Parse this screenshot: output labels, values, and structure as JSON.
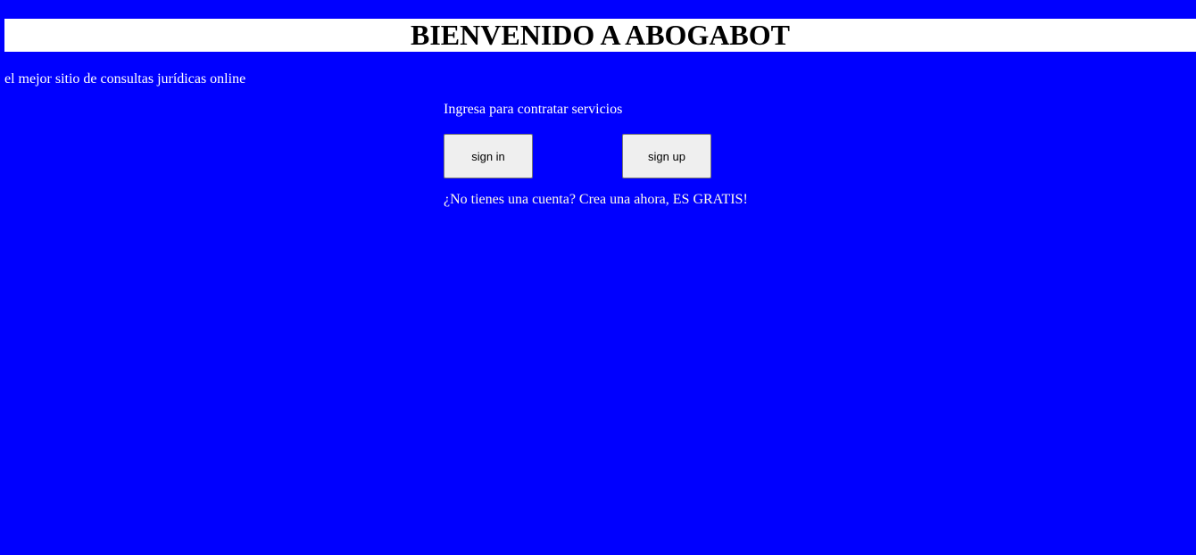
{
  "header": {
    "title": "BIENVENIDO A ABOGABOT"
  },
  "tagline": "el mejor sitio de consultas jurídicas online",
  "auth": {
    "prompt": "Ingresa para contratar servicios",
    "sign_in_label": "sign in",
    "sign_up_label": "sign up",
    "signup_note": "¿No tienes una cuenta? Crea una ahora, ES GRATIS!"
  },
  "colors": {
    "background": "#0000ff",
    "title_bar": "#ffffff",
    "text": "#ffffff",
    "button_bg": "#efefef"
  }
}
